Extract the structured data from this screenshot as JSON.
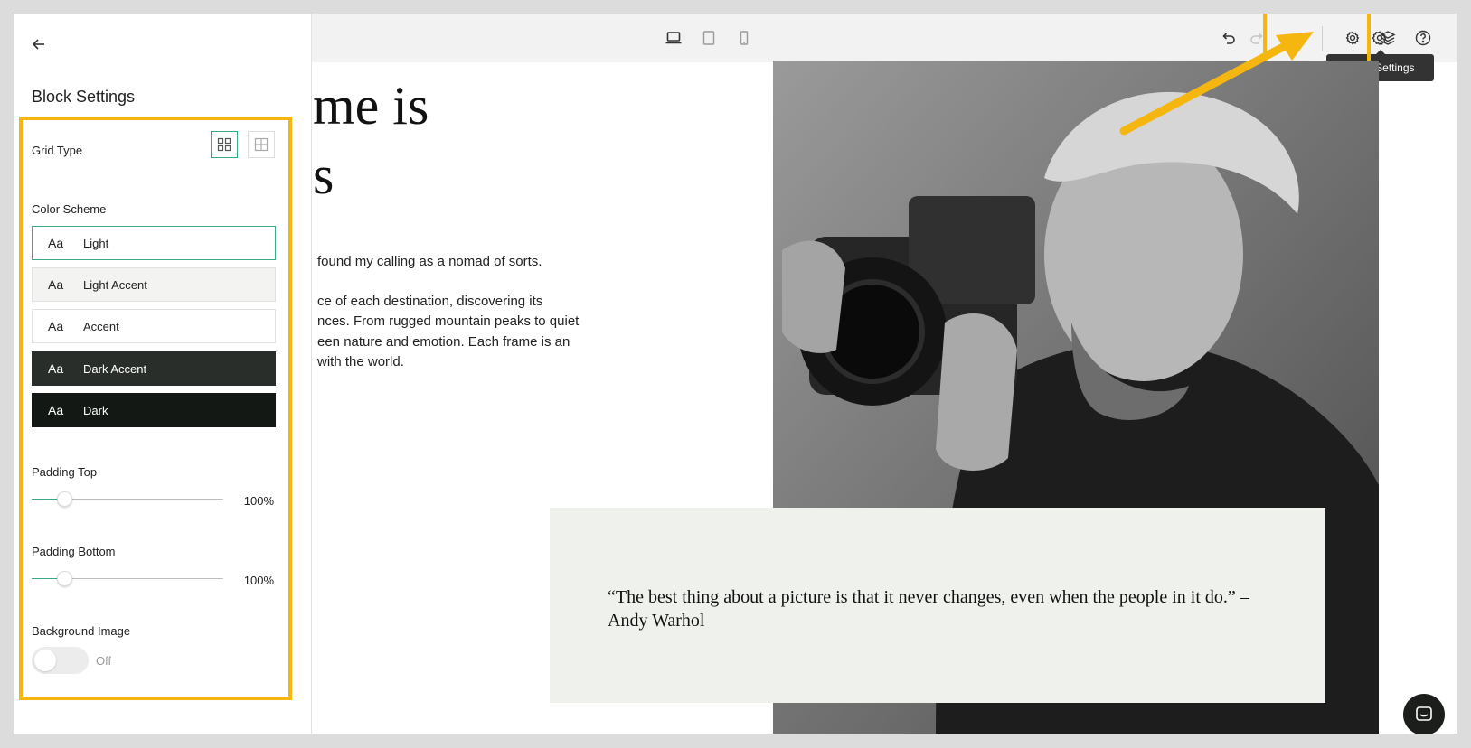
{
  "panel": {
    "title": "Block Settings",
    "grid_type_label": "Grid Type",
    "color_scheme_label": "Color Scheme",
    "schemes": [
      {
        "aa": "Aa",
        "label": "Light",
        "bg": "#ffffff",
        "fg": "#222222"
      },
      {
        "aa": "Aa",
        "label": "Light Accent",
        "bg": "#f3f3f1",
        "fg": "#222222"
      },
      {
        "aa": "Aa",
        "label": "Accent",
        "bg": "#ffffff",
        "fg": "#222222"
      },
      {
        "aa": "Aa",
        "label": "Dark Accent",
        "bg": "#2a2e2a",
        "fg": "#ffffff"
      },
      {
        "aa": "Aa",
        "label": "Dark",
        "bg": "#141815",
        "fg": "#ffffff"
      }
    ],
    "padding_top_label": "Padding Top",
    "padding_top_value": "100%",
    "padding_top_fraction": 0.17,
    "padding_bottom_label": "Padding Bottom",
    "padding_bottom_value": "100%",
    "padding_bottom_fraction": 0.17,
    "background_image_label": "Background Image",
    "background_image_state": "Off"
  },
  "toolbar": {
    "devices": [
      "laptop-icon",
      "tablet-icon",
      "mobile-icon"
    ],
    "tooltip": "Block Settings"
  },
  "content": {
    "headline": "me is\ns",
    "paragraphs": [
      "found my calling as a nomad of sorts.",
      "ce of each destination, discovering its\nnces. From rugged mountain peaks to quiet\neen nature and emotion. Each frame is an\nwith the world."
    ],
    "quote": "“The best thing about a picture is that it never changes, even when the people in it do.” – Andy Warhol"
  },
  "colors": {
    "highlight": "#f5b70f",
    "accent": "#3aa98a"
  }
}
